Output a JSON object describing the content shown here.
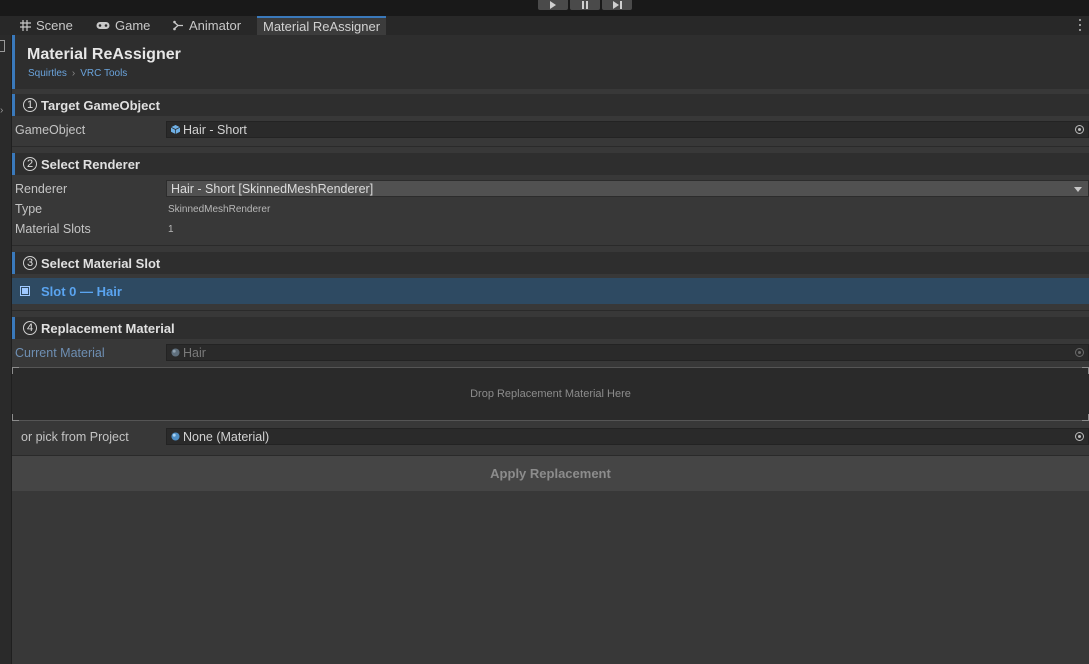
{
  "tabs": [
    {
      "label": "Scene",
      "icon": "grid-icon"
    },
    {
      "label": "Game",
      "icon": "gamepad-icon"
    },
    {
      "label": "Animator",
      "icon": "animator-icon"
    },
    {
      "label": "Material ReAssigner",
      "icon": null
    }
  ],
  "header": {
    "title": "Material ReAssigner",
    "breadcrumb": [
      "Squirtles",
      "VRC Tools"
    ],
    "breadcrumb_sep": "›"
  },
  "sections": [
    {
      "num": "1",
      "title": "Target GameObject"
    },
    {
      "num": "2",
      "title": "Select Renderer"
    },
    {
      "num": "3",
      "title": "Select Material Slot"
    },
    {
      "num": "4",
      "title": "Replacement Material"
    }
  ],
  "target": {
    "label": "GameObject",
    "value": "Hair - Short"
  },
  "renderer": {
    "label": "Renderer",
    "selected": "Hair - Short  [SkinnedMeshRenderer]",
    "type_label": "Type",
    "type_value": "SkinnedMeshRenderer",
    "slots_label": "Material Slots",
    "slots_value": "1"
  },
  "slot": {
    "label": "Slot 0  —  Hair",
    "selected": true
  },
  "replacement": {
    "current_label": "Current Material",
    "current_value": "Hair",
    "drop_text": "Drop Replacement Material Here",
    "pick_label": "or pick from Project",
    "pick_value": "None (Material)",
    "apply_label": "Apply Replacement"
  },
  "colors": {
    "accent": "#3a79bb",
    "slot_highlight": "#2e4a62",
    "slot_text": "#5aa4f0"
  }
}
